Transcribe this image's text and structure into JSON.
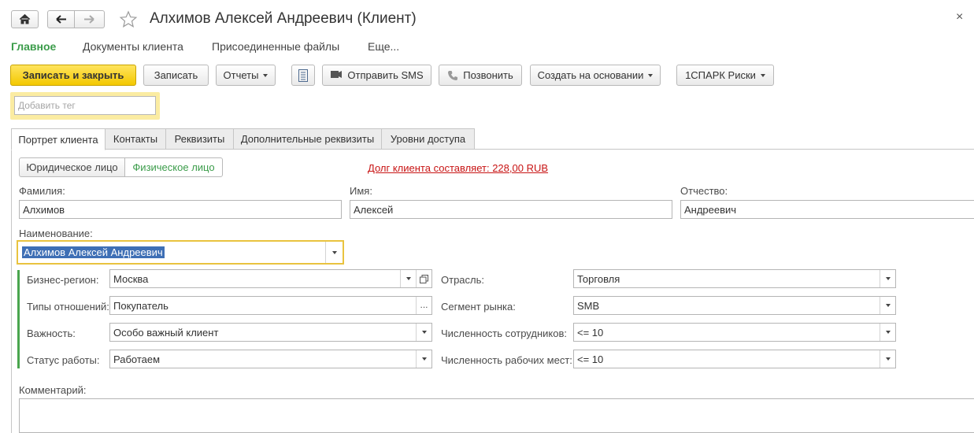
{
  "window": {
    "title": "Алхимов Алексей Андреевич (Клиент)",
    "close": "×"
  },
  "sections": [
    "Главное",
    "Документы клиента",
    "Присоединенные файлы",
    "Еще..."
  ],
  "toolbar": {
    "save_close": "Записать и закрыть",
    "save": "Записать",
    "reports": "Отчеты",
    "send_sms": "Отправить SMS",
    "call": "Позвонить",
    "create_based": "Создать на основании",
    "spark": "1СПАРК Риски"
  },
  "tag": {
    "placeholder": "Добавить тег"
  },
  "tabs": [
    "Портрет клиента",
    "Контакты",
    "Реквизиты",
    "Дополнительные реквизиты",
    "Уровни доступа"
  ],
  "person_type": {
    "legal": "Юридическое лицо",
    "individual": "Физическое лицо",
    "selected": "Физическое лицо"
  },
  "debt_text": "Долг клиента составляет: 228,00 RUB",
  "fio": {
    "last_name_label": "Фамилия:",
    "last_name": "Алхимов",
    "first_name_label": "Имя:",
    "first_name": "Алексей",
    "middle_name_label": "Отчество:",
    "middle_name": "Андреевич"
  },
  "naming": {
    "label": "Наименование:",
    "value": "Алхимов Алексей Андреевич"
  },
  "left_props": {
    "region_label": "Бизнес-регион:",
    "region": "Москва",
    "relation_label": "Типы отношений:",
    "relation": "Покупатель",
    "importance_label": "Важность:",
    "importance": "Особо важный клиент",
    "status_label": "Статус работы:",
    "status": "Работаем"
  },
  "right_props": {
    "industry_label": "Отрасль:",
    "industry": "Торговля",
    "segment_label": "Сегмент рынка:",
    "segment": "SMB",
    "employees_label": "Численность сотрудников:",
    "employees": "<= 10",
    "workplaces_label": "Численность рабочих мест:",
    "workplaces": "<= 10"
  },
  "comment": {
    "label": "Комментарий:"
  },
  "colors": {
    "accent_green": "#3b9c4a",
    "primary_yellow": "#f3c800",
    "debt_red": "#c81414",
    "selection_blue": "#3e6fb5"
  }
}
